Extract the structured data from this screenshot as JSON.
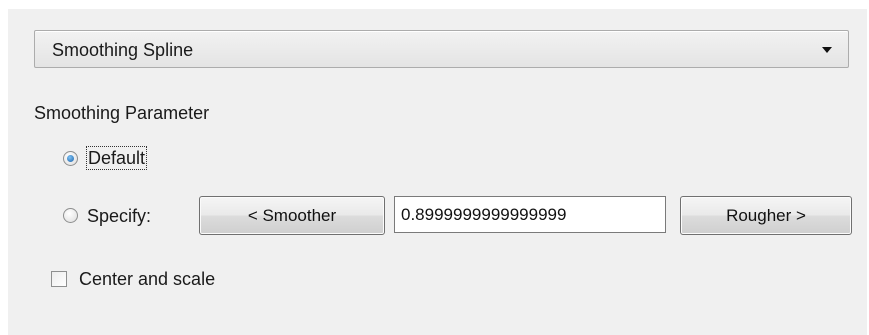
{
  "fit_type": {
    "selected": "Smoothing Spline"
  },
  "smoothing": {
    "section_label": "Smoothing Parameter",
    "default_label": "Default",
    "default_checked": true,
    "specify_label": "Specify:",
    "specify_checked": false,
    "smoother_label": "< Smoother",
    "value": "0.8999999999999999",
    "rougher_label": "Rougher >"
  },
  "center_scale": {
    "label": "Center and scale",
    "checked": false
  }
}
